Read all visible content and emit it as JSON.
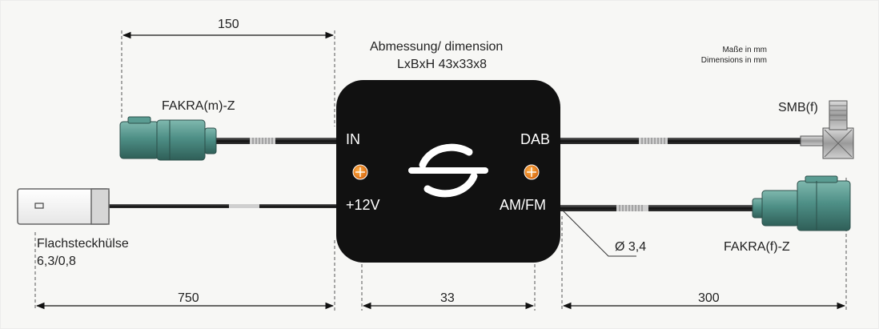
{
  "dimensions": {
    "top": "150",
    "bottom_left": "750",
    "bottom_middle": "33",
    "bottom_right": "300",
    "cable_diameter": "Ø 3,4"
  },
  "header": {
    "line1": "Abmessung/ dimension",
    "line2": "LxBxH 43x33x8"
  },
  "units_note": {
    "line1": "Maße in mm",
    "line2": "Dimensions in mm"
  },
  "connectors": {
    "fakra_m": "FAKRA(m)-Z",
    "smb_f": "SMB(f)",
    "fakra_f": "FAKRA(f)-Z",
    "flat_line1": "Flachsteckhülse",
    "flat_line2": "6,3/0,8"
  },
  "box_ports": {
    "in": "IN",
    "dab": "DAB",
    "v12": "+12V",
    "amfm": "AM/FM"
  },
  "colors": {
    "connector_green": "#4e8f86",
    "box_black": "#111111",
    "port_orange": "#e8781a"
  }
}
